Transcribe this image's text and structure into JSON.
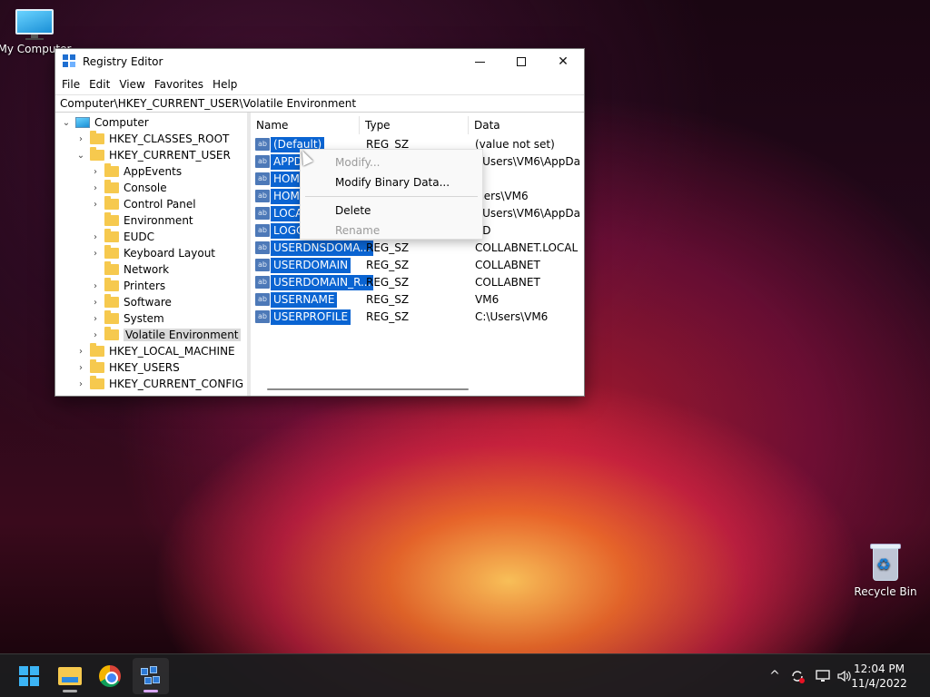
{
  "desktop": {
    "icons": [
      {
        "label": "My Computer",
        "icon": "monitor-icon"
      },
      {
        "label": "Recycle Bin",
        "icon": "recycle-bin-icon"
      }
    ]
  },
  "window": {
    "title": "Registry Editor",
    "controls": {
      "minimize": "minimize",
      "maximize": "maximize",
      "close": "✕"
    },
    "menu": [
      "File",
      "Edit",
      "View",
      "Favorites",
      "Help"
    ],
    "address": "Computer\\HKEY_CURRENT_USER\\Volatile Environment"
  },
  "tree": {
    "root": "Computer",
    "hives": [
      "HKEY_CLASSES_ROOT",
      "HKEY_CURRENT_USER",
      "HKEY_LOCAL_MACHINE",
      "HKEY_USERS",
      "HKEY_CURRENT_CONFIG"
    ],
    "hkcu_children": [
      "AppEvents",
      "Console",
      "Control Panel",
      "Environment",
      "EUDC",
      "Keyboard Layout",
      "Network",
      "Printers",
      "Software",
      "System",
      "Volatile Environment"
    ],
    "selected": "Volatile Environment"
  },
  "list": {
    "columns": [
      "Name",
      "Type",
      "Data"
    ],
    "rows": [
      {
        "name": "(Default)",
        "type": "REG_SZ",
        "data": "(value not set)"
      },
      {
        "name": "APPD",
        "type": "",
        "data": ":\\Users\\VM6\\AppDa"
      },
      {
        "name": "HOM",
        "type": "",
        "data": ":"
      },
      {
        "name": "HOM",
        "type": "",
        "data": "Jsers\\VM6"
      },
      {
        "name": "LOCA",
        "type": "",
        "data": ":\\Users\\VM6\\AppDa"
      },
      {
        "name": "LOGO",
        "type": "",
        "data": "AD"
      },
      {
        "name": "USERDNSDOMA...",
        "type": "REG_SZ",
        "data": "COLLABNET.LOCAL"
      },
      {
        "name": "USERDOMAIN",
        "type": "REG_SZ",
        "data": "COLLABNET"
      },
      {
        "name": "USERDOMAIN_R...",
        "type": "REG_SZ",
        "data": "COLLABNET"
      },
      {
        "name": "USERNAME",
        "type": "REG_SZ",
        "data": "VM6"
      },
      {
        "name": "USERPROFILE",
        "type": "REG_SZ",
        "data": "C:\\Users\\VM6"
      }
    ],
    "value_icon": "ab"
  },
  "context_menu": {
    "items": [
      {
        "label": "Modify...",
        "enabled": false
      },
      {
        "label": "Modify Binary Data...",
        "enabled": true
      },
      {
        "label": "Delete",
        "enabled": true
      },
      {
        "label": "Rename",
        "enabled": false
      }
    ]
  },
  "taskbar": {
    "apps": [
      "start-icon",
      "file-explorer-icon",
      "chrome-icon",
      "registry-editor-icon"
    ],
    "tray": {
      "chevron": "^"
    },
    "time": "12:04 PM",
    "date": "11/4/2022"
  },
  "colors": {
    "selection": "#0a64d2",
    "taskbar": "#1c1c1e",
    "folder": "#f6c94e"
  }
}
